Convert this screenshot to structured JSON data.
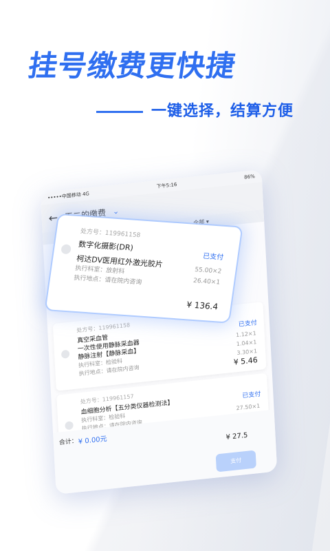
{
  "headline": "挂号缴费更快捷",
  "subline": "一键选择，结算方便",
  "status_bar": {
    "carrier": "•••••中国移动  4G",
    "time": "下午5:16",
    "battery": "86%"
  },
  "nav": {
    "back": "←",
    "title": "王二的缴费",
    "filter": "全部"
  },
  "float_card": {
    "rx": "处方号：119961158",
    "items": [
      "数字化摄影(DR)",
      "柯达DV医用红外激光胶片"
    ],
    "status": "已支付",
    "prices": [
      "55.00×2",
      "26.40×1"
    ],
    "dept": "执行科室：放射科",
    "loc": "执行地点：请在院内咨询",
    "total": "¥ 136.4"
  },
  "cards": [
    {
      "rx": "处方号：119961158",
      "items": [
        "真空采血管",
        "一次性使用静脉采血器",
        "静脉注射【静脉采血】"
      ],
      "status": "已支付",
      "prices": [
        "1.12×1",
        "1.04×1",
        "3.30×1"
      ],
      "dept": "执行科室：检验科",
      "loc": "执行地点：请在院内咨询",
      "total": "¥ 5.46"
    },
    {
      "rx": "处方号：119961157",
      "items": [
        "血细胞分析【五分类仪器检测法】"
      ],
      "status": "已支付",
      "prices": [
        "27.50×1"
      ],
      "dept": "执行科室：检验科",
      "loc": "执行地点：请在院内咨询",
      "total": "¥ 27.5"
    }
  ],
  "footer": {
    "sum_label": "合计：",
    "sum_value": "¥ 0.00元",
    "pay": "支付"
  },
  "colors": {
    "accent": "#2f6ff0"
  }
}
